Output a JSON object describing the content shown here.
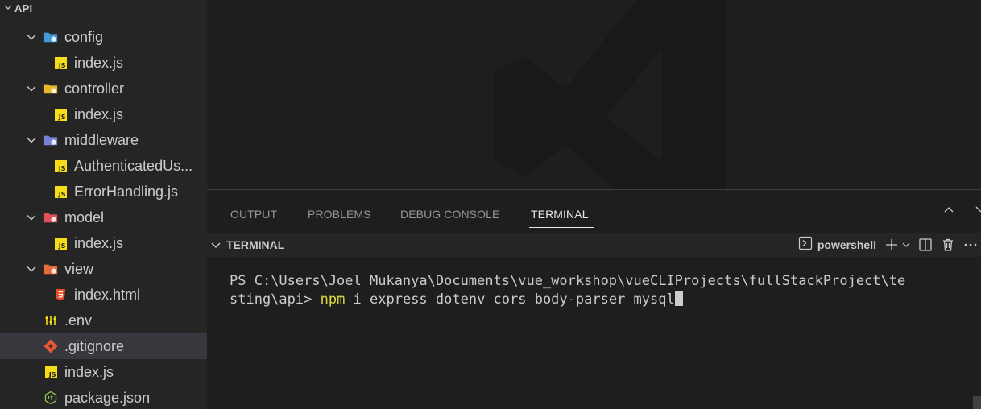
{
  "explorer": {
    "section_title": "API",
    "items": [
      {
        "label": "config",
        "type": "folder",
        "icon": "config-folder-icon",
        "color": "#3e9bd8"
      },
      {
        "label": "index.js",
        "type": "js-file",
        "icon": "javascript-file-icon"
      },
      {
        "label": "controller",
        "type": "folder",
        "icon": "controller-folder-icon",
        "color": "#e8b62c"
      },
      {
        "label": "index.js",
        "type": "js-file",
        "icon": "javascript-file-icon"
      },
      {
        "label": "middleware",
        "type": "folder",
        "icon": "middleware-folder-icon",
        "color": "#7680d6"
      },
      {
        "label": "AuthenticatedUs...",
        "type": "js-file",
        "icon": "javascript-file-icon"
      },
      {
        "label": "ErrorHandling.js",
        "type": "js-file",
        "icon": "javascript-file-icon"
      },
      {
        "label": "model",
        "type": "folder",
        "icon": "model-folder-icon",
        "color": "#e0505a"
      },
      {
        "label": "index.js",
        "type": "js-file",
        "icon": "javascript-file-icon"
      },
      {
        "label": "view",
        "type": "folder",
        "icon": "view-folder-icon",
        "color": "#e86a3a"
      },
      {
        "label": "index.html",
        "type": "html-file",
        "icon": "html-file-icon",
        "color": "#e44d26"
      },
      {
        "label": ".env",
        "type": "env-file",
        "icon": "env-file-icon",
        "color": "#f5de19"
      },
      {
        "label": ".gitignore",
        "type": "git-file",
        "icon": "git-icon",
        "color": "#e8573c",
        "selected": true
      },
      {
        "label": "index.js",
        "type": "js-file",
        "icon": "javascript-file-icon"
      },
      {
        "label": "package.json",
        "type": "node-file",
        "icon": "nodejs-icon",
        "color": "#8cc84b"
      }
    ]
  },
  "panel": {
    "tabs": [
      {
        "label": "OUTPUT"
      },
      {
        "label": "PROBLEMS"
      },
      {
        "label": "DEBUG CONSOLE"
      },
      {
        "label": "TERMINAL",
        "active": true
      }
    ],
    "terminal_title": "TERMINAL",
    "shell_name": "powershell"
  },
  "terminal": {
    "line1": "PS C:\\Users\\Joel Mukanya\\Documents\\vue_workshop\\vueCLIProjects\\fullStackProject\\te",
    "line2_prefix": "sting\\api> ",
    "line2_cmd": "npm",
    "line2_rest": " i express dotenv cors body-parser mysql"
  },
  "colors": {
    "sidebar_bg": "#252526",
    "editor_bg": "#1e1e1e",
    "selection_bg": "#37373d",
    "command_highlight": "#dcdc40"
  }
}
